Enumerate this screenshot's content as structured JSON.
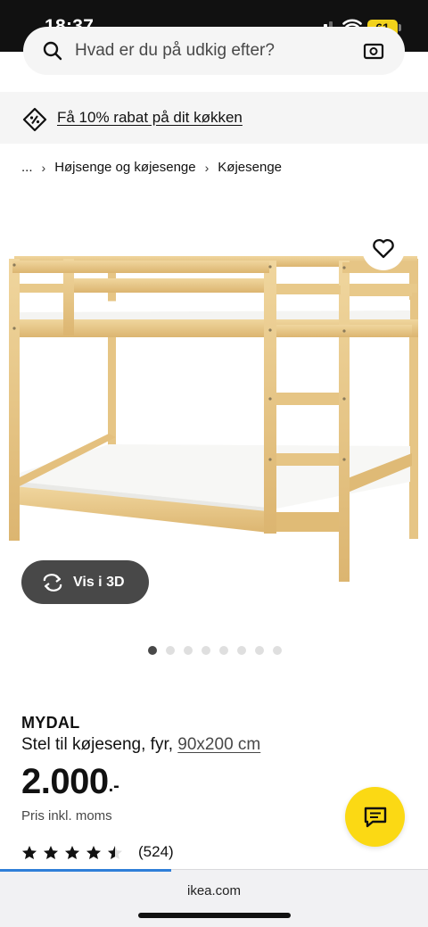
{
  "status_bar": {
    "time": "18:37",
    "battery": "61"
  },
  "search": {
    "placeholder": "Hvad er du på udkig efter?"
  },
  "promo": {
    "text": "Få 10% rabat på dit køkken",
    "icon": "discount-tag-icon"
  },
  "breadcrumb": {
    "items": [
      {
        "label": "..."
      },
      {
        "label": "Højsenge og køjesenge"
      },
      {
        "label": "Køjesenge"
      }
    ]
  },
  "product_gallery": {
    "view_3d_label": "Vis i 3D",
    "active_image": 1,
    "image_count": 8
  },
  "product": {
    "name": "MYDAL",
    "description": "Stel til køjeseng, fyr,",
    "size": "90x200 cm",
    "price_integer": "2.000",
    "price_decimals": ".-",
    "vat_note": "Pris inkl. moms",
    "rating": 4.5,
    "rating_max": 5,
    "review_count": "(524)"
  },
  "browser": {
    "url": "ikea.com",
    "load_progress": 0.4
  },
  "colors": {
    "accent_yellow": "#fbd914",
    "dark_grey": "#484848",
    "progress_blue": "#2f7fd8"
  }
}
